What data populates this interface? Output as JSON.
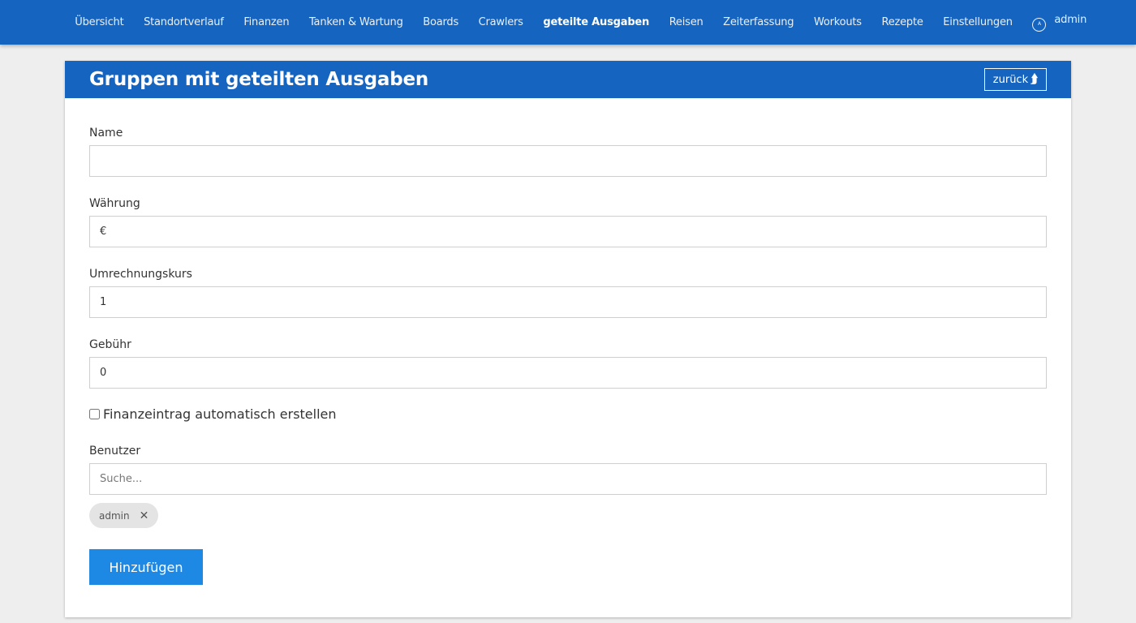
{
  "nav": {
    "items": [
      {
        "label": "Übersicht"
      },
      {
        "label": "Standortverlauf"
      },
      {
        "label": "Finanzen"
      },
      {
        "label": "Tanken & Wartung"
      },
      {
        "label": "Boards"
      },
      {
        "label": "Crawlers"
      },
      {
        "label": "geteilte Ausgaben",
        "active": true
      },
      {
        "label": "Reisen"
      },
      {
        "label": "Zeiterfassung"
      },
      {
        "label": "Workouts"
      },
      {
        "label": "Rezepte"
      },
      {
        "label": "Einstellungen"
      }
    ],
    "user": {
      "icon": "user-circle-icon",
      "initial": "A",
      "name": "admin"
    }
  },
  "card": {
    "title": "Gruppen mit geteilten Ausgaben",
    "back_label": "zurück",
    "back_icon": "arrow-up-icon",
    "back_glyph": "⮭"
  },
  "form": {
    "name": {
      "label": "Name",
      "value": ""
    },
    "currency": {
      "label": "Währung",
      "value": "€"
    },
    "exchange_rate": {
      "label": "Umrechnungskurs",
      "value": "1"
    },
    "fee": {
      "label": "Gebühr",
      "value": "0"
    },
    "auto_finance": {
      "label": "Finanzeintrag automatisch erstellen",
      "checked": false
    },
    "users": {
      "label": "Benutzer",
      "search_placeholder": "Suche...",
      "selected": [
        {
          "name": "admin",
          "remove_glyph": "✕"
        }
      ]
    },
    "submit_label": "Hinzufügen"
  },
  "colors": {
    "primary": "#1565c0",
    "button": "#1e88e5",
    "background": "#eeeeee",
    "chip": "#e4e4e4"
  }
}
